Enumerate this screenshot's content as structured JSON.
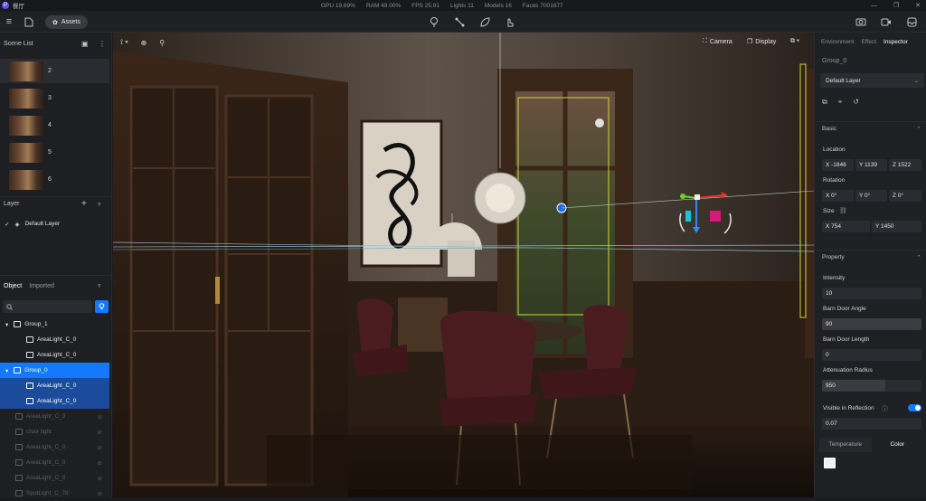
{
  "titlebar": {
    "app_title": "餐厅",
    "stats": [
      "GPU 19.69%",
      "RAM 49.00%",
      "FPS 25.91",
      "Lights 11",
      "Models 16",
      "Faces 7001677"
    ]
  },
  "toolbar": {
    "assets_label": "Assets",
    "center_tools": [
      "bulb-icon",
      "path-icon",
      "leaf-icon",
      "pointer-icon"
    ]
  },
  "scene_list": {
    "title": "Scene List",
    "scenes": [
      "2",
      "3",
      "4",
      "5",
      "6"
    ]
  },
  "layer": {
    "title": "Layer",
    "items": [
      "Default Layer"
    ]
  },
  "object_panel": {
    "tabs": [
      "Object",
      "Imported"
    ],
    "search_placeholder": "",
    "tree": [
      {
        "label": "Group_1",
        "type": "group",
        "state": "normal"
      },
      {
        "label": "AreaLight_C_0",
        "type": "child",
        "state": "normal"
      },
      {
        "label": "AreaLight_C_0",
        "type": "child",
        "state": "normal"
      },
      {
        "label": "Group_0",
        "type": "group",
        "state": "selected"
      },
      {
        "label": "AreaLight_C_0",
        "type": "child",
        "state": "selected-child"
      },
      {
        "label": "AreaLight_C_0",
        "type": "child",
        "state": "selected-child"
      },
      {
        "label": "AreaLight_C_0",
        "type": "item",
        "state": "dim"
      },
      {
        "label": "chair light",
        "type": "item",
        "state": "dim"
      },
      {
        "label": "AreaLight_C_0",
        "type": "item",
        "state": "dim"
      },
      {
        "label": "AreaLight_C_0",
        "type": "item",
        "state": "dim"
      },
      {
        "label": "AreaLight_C_0",
        "type": "item",
        "state": "dim"
      },
      {
        "label": "SpotLight_C_78",
        "type": "item",
        "state": "dim"
      }
    ]
  },
  "viewport": {
    "camera_label": "Camera",
    "display_label": "Display"
  },
  "inspector": {
    "tabs": [
      "Environment",
      "Effect",
      "Inspector"
    ],
    "active_tab": "Inspector",
    "object_name": "Group_0",
    "layer_value": "Default Layer",
    "basic_title": "Basic",
    "location_label": "Location",
    "location": {
      "x": "X -1846",
      "y": "Y 1139",
      "z": "Z 1522"
    },
    "rotation_label": "Rotation",
    "rotation": {
      "x": "X 0°",
      "y": "Y 0°",
      "z": "Z 0°"
    },
    "size_label": "Size",
    "size": {
      "x": "X 754",
      "y": "Y 1450"
    },
    "property_title": "Property",
    "intensity_label": "Intensity",
    "intensity_value": "10",
    "barn_angle_label": "Barn Door Angle",
    "barn_angle_value": "90",
    "barn_length_label": "Barn Door Length",
    "barn_length_value": "0",
    "atten_label": "Attenuation Radius",
    "atten_value": "950",
    "visible_reflection_label": "Visible in Reflection",
    "visible_reflection_value": "0.07",
    "temperature_tab": "Temperature",
    "color_tab": "Color"
  },
  "colors": {
    "accent": "#1479ff",
    "selected_child": "#1b4b9a",
    "panel": "#1f2024"
  }
}
